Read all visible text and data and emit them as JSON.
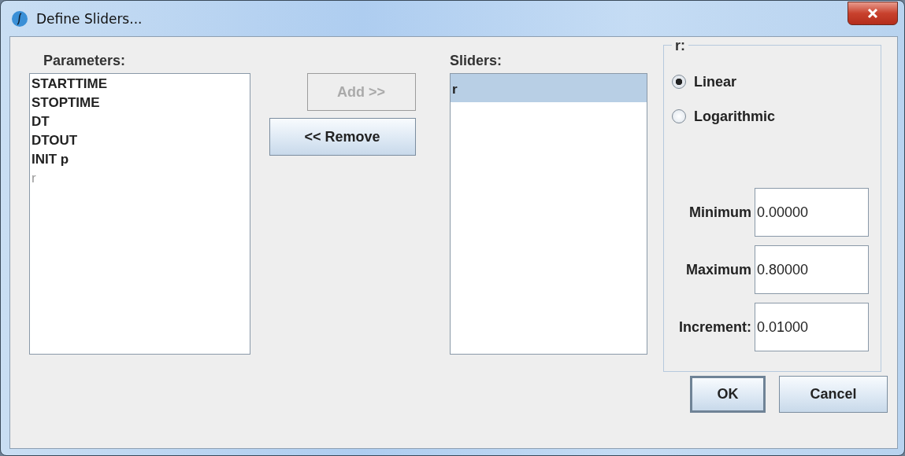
{
  "window": {
    "title": "Define Sliders..."
  },
  "parameters": {
    "label": "Parameters:",
    "items": [
      {
        "text": "STARTTIME",
        "disabled": false
      },
      {
        "text": "STOPTIME",
        "disabled": false
      },
      {
        "text": "DT",
        "disabled": false
      },
      {
        "text": "DTOUT",
        "disabled": false
      },
      {
        "text": "INIT p",
        "disabled": false
      },
      {
        "text": "r",
        "disabled": true
      }
    ]
  },
  "add_button": {
    "label": "Add >>",
    "disabled": true
  },
  "remove_button": {
    "label": "<< Remove",
    "disabled": false
  },
  "sliders": {
    "label": "Sliders:",
    "items": [
      {
        "text": "r",
        "selected": true
      }
    ]
  },
  "slider_settings": {
    "title": "r:",
    "scales": [
      {
        "label": "Linear",
        "selected": true
      },
      {
        "label": "Logarithmic",
        "selected": false
      }
    ],
    "fields": [
      {
        "label": "Minimum",
        "value": "0.00000"
      },
      {
        "label": "Maximum",
        "value": "0.80000"
      },
      {
        "label": "Increment:",
        "value": "0.01000"
      }
    ]
  },
  "buttons": [
    {
      "label": "OK",
      "default": true
    },
    {
      "label": "Cancel",
      "default": false
    }
  ]
}
